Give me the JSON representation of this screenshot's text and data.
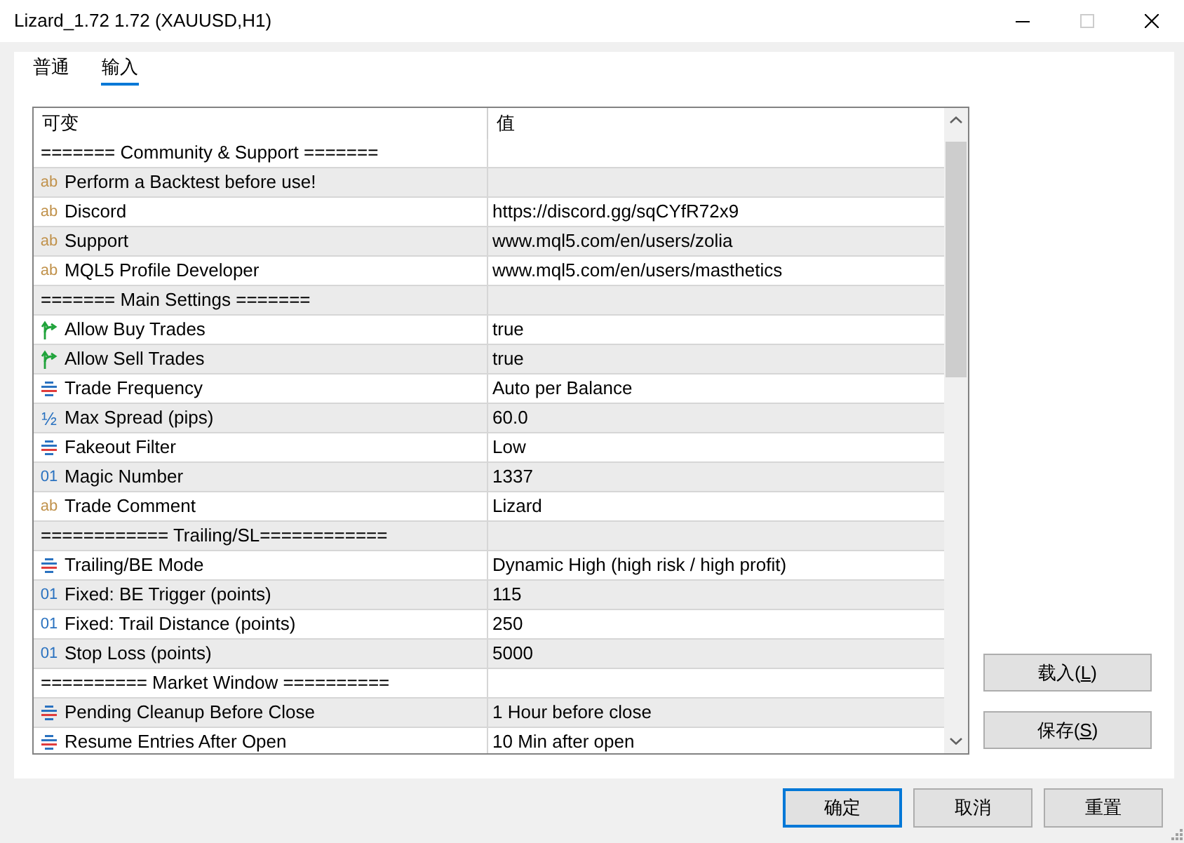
{
  "window": {
    "title": "Lizard_1.72 1.72 (XAUUSD,H1)",
    "controls": [
      {
        "kind": "minimize",
        "disabled": false
      },
      {
        "kind": "maximize",
        "disabled": true
      },
      {
        "kind": "close",
        "disabled": false
      }
    ]
  },
  "tabs": [
    {
      "label": "普通",
      "selected": false
    },
    {
      "label": "输入",
      "selected": true
    }
  ],
  "parameters": {
    "columns": [
      "可变",
      "值"
    ],
    "rows": [
      {
        "kind": "separator",
        "name": "======= Community & Support ======="
      },
      {
        "kind": "string",
        "icon": "ab",
        "name": "Perform a Backtest before use!"
      },
      {
        "kind": "string",
        "icon": "ab",
        "name": "Discord",
        "value": "https://discord.gg/sqCYfR72x9"
      },
      {
        "kind": "string",
        "icon": "ab",
        "name": "Support",
        "value": "www.mql5.com/en/users/zolia"
      },
      {
        "kind": "string",
        "icon": "ab",
        "name": "MQL5 Profile Developer",
        "value": "www.mql5.com/en/users/masthetics"
      },
      {
        "kind": "separator",
        "name": "======= Main Settings ======="
      },
      {
        "kind": "bool",
        "name": "Allow Buy Trades",
        "value": "true"
      },
      {
        "kind": "bool",
        "name": "Allow Sell Trades",
        "value": "true"
      },
      {
        "kind": "enum",
        "name": "Trade Frequency",
        "value": "Auto per Balance"
      },
      {
        "kind": "double",
        "icon": "½",
        "name": "Max Spread (pips)",
        "value": "60.0"
      },
      {
        "kind": "enum",
        "name": "Fakeout Filter",
        "value": "Low"
      },
      {
        "kind": "int",
        "icon": "01",
        "name": "Magic Number",
        "value": "1337"
      },
      {
        "kind": "string",
        "icon": "ab",
        "name": "Trade Comment",
        "value": "Lizard"
      },
      {
        "kind": "separator",
        "name": "============ Trailing/SL============"
      },
      {
        "kind": "enum",
        "name": "Trailing/BE Mode",
        "value": "Dynamic High (high risk / high profit)"
      },
      {
        "kind": "int",
        "icon": "01",
        "name": "Fixed: BE Trigger (points)",
        "value": "115"
      },
      {
        "kind": "int",
        "icon": "01",
        "name": "Fixed: Trail Distance (points)",
        "value": "250"
      },
      {
        "kind": "int",
        "icon": "01",
        "name": "Stop Loss (points)",
        "value": "5000"
      },
      {
        "kind": "separator",
        "name": "========== Market Window =========="
      },
      {
        "kind": "enum",
        "name": "Pending Cleanup Before Close",
        "value": "1 Hour before close"
      },
      {
        "kind": "enum",
        "name": "Resume Entries After Open",
        "value": "10 Min after open"
      }
    ]
  },
  "side_buttons": [
    {
      "text": "载入(",
      "access_key": "L",
      "text_after": ")"
    },
    {
      "text": "保存(",
      "access_key": "S",
      "text_after": ")"
    }
  ],
  "footer_buttons": [
    {
      "label": "确定",
      "default": true
    },
    {
      "label": "取消",
      "default": false
    },
    {
      "label": "重置",
      "default": false
    }
  ]
}
